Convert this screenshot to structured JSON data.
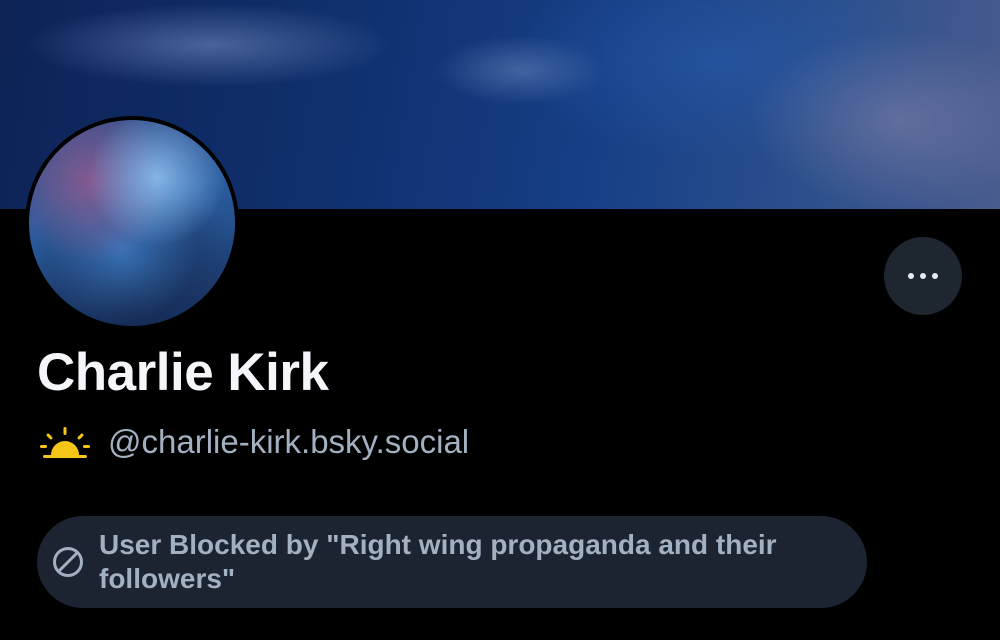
{
  "profile": {
    "display_name": "Charlie Kirk",
    "handle": "@charlie-kirk.bsky.social",
    "handle_icon": "sunrise-icon",
    "more_button_icon": "ellipsis-icon"
  },
  "moderation": {
    "block_message": "User Blocked by \"Right wing propaganda and their followers\"",
    "block_icon": "ban-icon"
  },
  "colors": {
    "background": "#000000",
    "banner": "#163f86",
    "sunrise_icon": "#f5c518",
    "muted_text": "#a3b0c2",
    "pill_background": "#1b2430"
  }
}
